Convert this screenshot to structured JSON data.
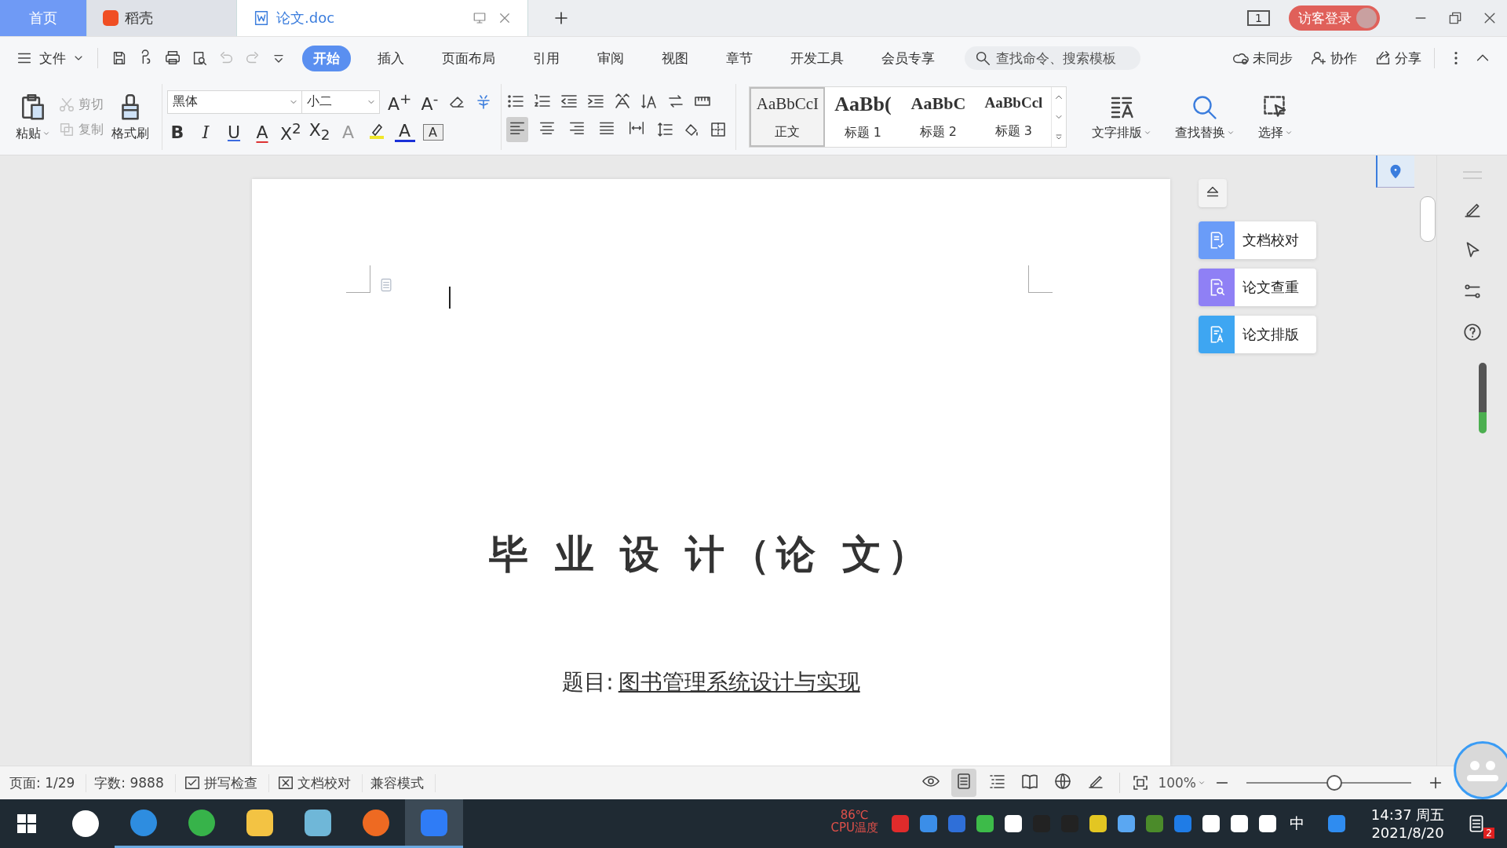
{
  "tabs": [
    {
      "kind": "home",
      "label": "首页",
      "selected": false
    },
    {
      "kind": "app",
      "label": "稻壳",
      "selected": false
    },
    {
      "kind": "doc",
      "label": "论文.doc",
      "selected": true
    }
  ],
  "account": {
    "page_count": "1",
    "login": "访客登录"
  },
  "menu": {
    "file": "文件",
    "tabs": [
      {
        "label": "开始",
        "selected": true
      },
      {
        "label": "插入",
        "selected": false
      },
      {
        "label": "页面布局",
        "selected": false
      },
      {
        "label": "引用",
        "selected": false
      },
      {
        "label": "审阅",
        "selected": false
      },
      {
        "label": "视图",
        "selected": false
      },
      {
        "label": "章节",
        "selected": false
      },
      {
        "label": "开发工具",
        "selected": false
      },
      {
        "label": "会员专享",
        "selected": false
      }
    ],
    "search": {
      "placeholder": "查找命令、搜索模板"
    },
    "actions": [
      {
        "kind": "sync",
        "label": "未同步"
      },
      {
        "kind": "collab",
        "label": "协作"
      },
      {
        "kind": "share",
        "label": "分享"
      }
    ]
  },
  "ribbon": {
    "clipboard": [
      {
        "kind": "paste",
        "label": "粘贴",
        "disabled": false
      },
      {
        "kind": "cut",
        "label": "剪切",
        "disabled": true
      },
      {
        "kind": "copy",
        "label": "复制",
        "disabled": true
      },
      {
        "kind": "brush",
        "label": "格式刷",
        "disabled": false
      }
    ],
    "font": {
      "value": "黑体"
    },
    "size": {
      "value": "小二"
    },
    "font_row1": [
      {
        "text": "A$^{+}$"
      },
      {
        "text": "A$^{-}$"
      }
    ],
    "font_row2": [
      {
        "kind": "bold",
        "text": "B",
        "disabled": false
      },
      {
        "kind": "italic",
        "text": "I",
        "disabled": false
      },
      {
        "kind": "underline",
        "text": "U",
        "disabled": false
      },
      {
        "kind": "strike",
        "text": "A",
        "disabled": false
      },
      {
        "kind": "sup",
        "text": "X$^{2}$",
        "disabled": false
      },
      {
        "kind": "sub",
        "text": "X$_{2}$",
        "disabled": false
      },
      {
        "kind": "effect",
        "text": "A",
        "disabled": true
      },
      {
        "kind": "highlight"
      },
      {
        "kind": "color",
        "text": "A",
        "disabled": false
      },
      {
        "kind": "shade",
        "text": "A",
        "disabled": false
      }
    ],
    "alignment": [
      {
        "kind": "left",
        "selected": true
      },
      {
        "kind": "center",
        "selected": false
      },
      {
        "kind": "right",
        "selected": false
      },
      {
        "kind": "justify",
        "selected": false
      },
      {
        "kind": "distribute",
        "selected": false
      }
    ],
    "styles": [
      {
        "sample": "AaBbCcI",
        "label": "正文",
        "kind": "normal",
        "selected": true
      },
      {
        "sample": "AaBb(",
        "label": "标题 1",
        "kind": "h1",
        "selected": false
      },
      {
        "sample": "AaBbC",
        "label": "标题 2",
        "kind": "h2",
        "selected": false
      },
      {
        "sample": "AaBbCcl",
        "label": "标题 3",
        "kind": "h3",
        "selected": false
      }
    ],
    "tools": [
      {
        "kind": "layout",
        "label": "文字排版"
      },
      {
        "kind": "find",
        "label": "查找替换"
      },
      {
        "kind": "select",
        "label": "选择"
      }
    ]
  },
  "document": {
    "title": "毕 业 设 计（论 文）",
    "subject_label": "题目:",
    "subject": "图书管理系统设计与实现"
  },
  "side_panel": [
    {
      "kind": "proof",
      "label": "文档校对",
      "color": "#6a9cf8"
    },
    {
      "kind": "check",
      "label": "论文查重",
      "color": "#8f80f5"
    },
    {
      "kind": "format",
      "label": "论文排版",
      "color": "#3ea6f2"
    }
  ],
  "status_bar": {
    "page": "页面: 1/29",
    "words": "字数: 9888",
    "spell": "拼写检查",
    "proof": "文档校对",
    "mode": "兼容模式",
    "zoom": "100%",
    "zoom_slider": {
      "level": 0.53
    },
    "view_modes": [
      {
        "kind": "eye",
        "selected": false
      },
      {
        "kind": "page",
        "selected": true
      },
      {
        "kind": "outline",
        "selected": false
      },
      {
        "kind": "book",
        "selected": false
      },
      {
        "kind": "web",
        "selected": false
      },
      {
        "kind": "pen",
        "selected": false
      }
    ]
  },
  "taskbar": {
    "apps": [
      {
        "kind": "pinwheel",
        "running": false,
        "selected": false
      },
      {
        "kind": "ie",
        "running": true,
        "selected": false
      },
      {
        "kind": "browser",
        "running": true,
        "selected": false
      },
      {
        "kind": "folder",
        "running": true,
        "selected": false
      },
      {
        "kind": "notepad",
        "running": true,
        "selected": false
      },
      {
        "kind": "raccoon",
        "running": true,
        "selected": false
      },
      {
        "kind": "wps",
        "running": true,
        "selected": true
      }
    ],
    "cpu_temp": "86℃",
    "cpu_label": "CPU温度",
    "ime": "中",
    "time": "14:37 周五",
    "date": "2021/8/20",
    "notifications": "2"
  }
}
